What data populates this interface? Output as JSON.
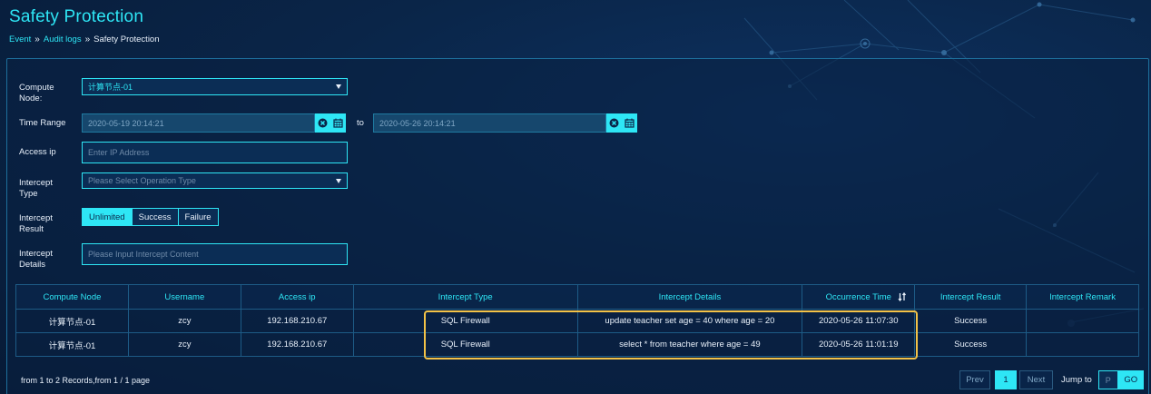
{
  "page": {
    "title": "Safety Protection",
    "breadcrumb": [
      "Event",
      "Audit logs",
      "Safety Protection"
    ]
  },
  "form": {
    "compute_node": {
      "label": "Compute Node:",
      "value": "计算节点-01"
    },
    "time_range": {
      "label": "Time Range",
      "start": "2020-05-19 20:14:21",
      "to": "to",
      "end": "2020-05-26 20:14:21"
    },
    "access_ip": {
      "label": "Access ip",
      "placeholder": "Enter IP Address"
    },
    "intercept_type": {
      "label": "Intercept Type",
      "placeholder": "Please Select Operation Type"
    },
    "intercept_result": {
      "label": "Intercept Result",
      "options": [
        "Unlimited",
        "Success",
        "Failure"
      ],
      "selected": "Unlimited"
    },
    "intercept_details": {
      "label": "Intercept Details",
      "placeholder": "Please Input Intercept Content"
    }
  },
  "table": {
    "columns": [
      "Compute Node",
      "Username",
      "Access ip",
      "Intercept Type",
      "Intercept Details",
      "Occurrence Time",
      "Intercept Result",
      "Intercept Remark"
    ],
    "rows": [
      [
        "计算节点-01",
        "zcy",
        "192.168.210.67",
        "SQL Firewall",
        "update teacher set age = 40 where age = 20",
        "2020-05-26 11:07:30",
        "Success",
        ""
      ],
      [
        "计算节点-01",
        "zcy",
        "192.168.210.67",
        "SQL Firewall",
        "select * from teacher where age = 49",
        "2020-05-26 11:01:19",
        "Success",
        ""
      ]
    ]
  },
  "footer": {
    "records_info": "from 1 to 2 Records,from 1 / 1 page",
    "prev": "Prev",
    "current_page": "1",
    "next": "Next",
    "jump_to": "Jump to",
    "page_placeholder": "P",
    "go": "GO"
  },
  "colors": {
    "accent": "#2ee6f5",
    "background": "#0a2548",
    "highlight": "#f3c247"
  },
  "icons": [
    "clear-icon",
    "calendar-icon",
    "sort-icon",
    "chevron-down-icon"
  ]
}
